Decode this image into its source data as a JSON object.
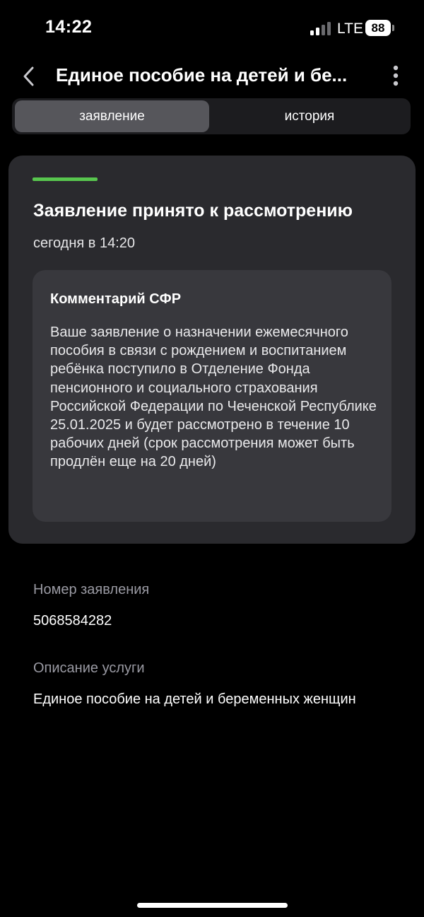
{
  "status_bar": {
    "time": "14:22",
    "network": "LTE",
    "battery": "88"
  },
  "header": {
    "title": "Единое пособие на детей и бе..."
  },
  "tabs": [
    {
      "label": "заявление",
      "active": true
    },
    {
      "label": "история",
      "active": false
    }
  ],
  "status_card": {
    "accent_color": "#58c64e",
    "title": "Заявление принято к рассмотрению",
    "date": "сегодня в 14:20",
    "comment": {
      "title": "Комментарий СФР",
      "text": "Ваше заявление о назначении ежемесячного пособия в связи с рождением и воспитанием ребёнка поступило в Отделение Фонда пенсионного и социального страхования Российской Федерации по Чеченской Республике 25.01.2025 и будет рассмотрено в течение 10 рабочих дней (срок рассмотрения может быть продлён еще на 20 дней)"
    }
  },
  "details": {
    "number_label": "Номер заявления",
    "number_value": "5068584282",
    "description_label": "Описание услуги",
    "description_value": "Единое пособие на детей и беременных женщин"
  },
  "icons": {
    "back": "chevron-left-icon",
    "more": "more-vertical-icon",
    "signal": "cellular-signal-icon",
    "battery": "battery-icon"
  }
}
